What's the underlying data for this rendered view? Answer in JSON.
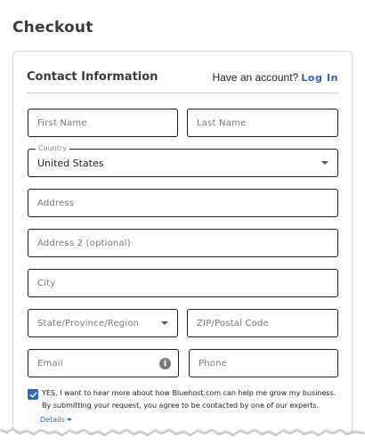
{
  "page": {
    "title": "Checkout"
  },
  "contact": {
    "section_title": "Contact Information",
    "account_prompt": "Have an account?",
    "login_label": "Log In"
  },
  "form": {
    "first_name_placeholder": "First Name",
    "last_name_placeholder": "Last Name",
    "country_label": "Country",
    "country_value": "United States",
    "address_placeholder": "Address",
    "address2_placeholder": "Address 2 (optional)",
    "city_placeholder": "City",
    "state_placeholder": "State/Province/Region",
    "zip_placeholder": "ZIP/Postal Code",
    "email_placeholder": "Email",
    "phone_placeholder": "Phone"
  },
  "consent": {
    "checked": true,
    "line1": "YES, I want to hear more about how Bluehost.com can help me grow my business.",
    "line2": "By submitting your request, you agree to be contacted by one of our experts.",
    "details_label": "Details"
  },
  "colors": {
    "accent": "#2c65c4",
    "border": "#1f1f1f",
    "title": "#3b3b3b"
  }
}
